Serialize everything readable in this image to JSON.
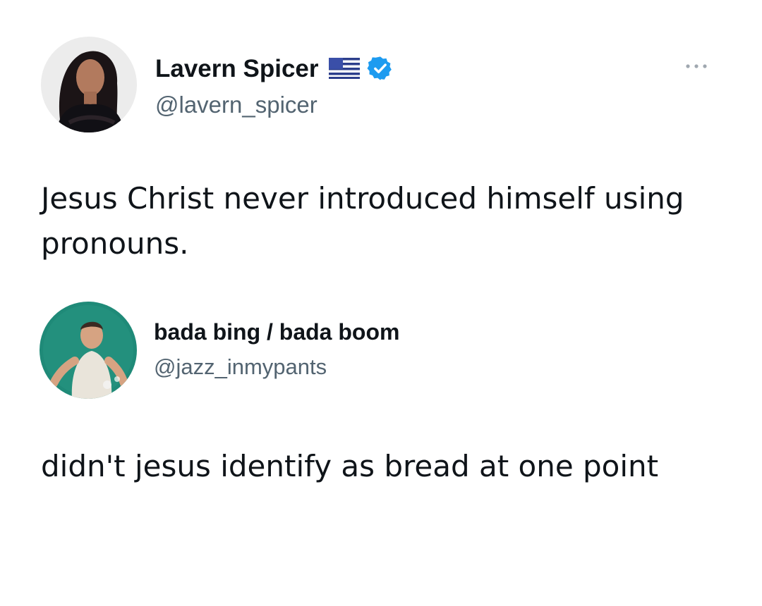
{
  "tweet": {
    "author": {
      "display_name": "Lavern Spicer",
      "handle": "@lavern_spicer",
      "verified": true,
      "flag_icon": "us-flag-icon"
    },
    "text": "Jesus Christ never introduced himself using pronouns."
  },
  "reply": {
    "author": {
      "display_name": "bada bing / bada boom",
      "handle": "@jazz_inmypants"
    },
    "text": "didn't jesus identify as bread at one point"
  },
  "colors": {
    "text_primary": "#0f1419",
    "text_secondary": "#536471",
    "verified_blue": "#1d9bf0",
    "avatar2_bg": "#1f8a78"
  }
}
